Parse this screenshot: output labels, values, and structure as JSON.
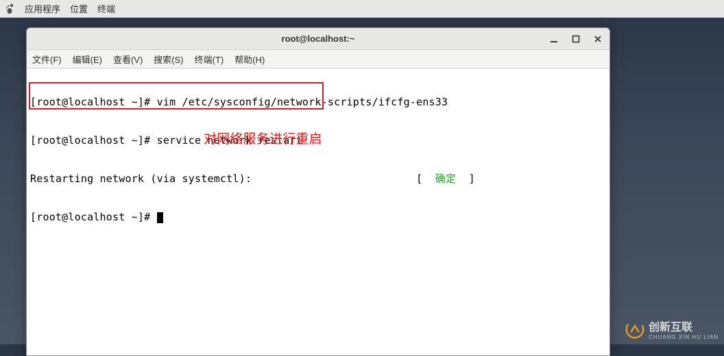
{
  "panel": {
    "apps": "应用程序",
    "places": "位置",
    "terminal": "终端"
  },
  "window": {
    "title": "root@localhost:~"
  },
  "menubar": {
    "file": "文件(F)",
    "edit": "编辑(E)",
    "view": "查看(V)",
    "search": "搜索(S)",
    "terminal": "终端(T)",
    "help": "帮助(H)"
  },
  "terminal": {
    "line1_prompt": "[root@localhost ~]# ",
    "line1_cmd": "vim /etc/sysconfig/network-scripts/ifcfg-ens33",
    "line2_prompt": "[root@localhost ~]# ",
    "line2_cmd": "service network restart",
    "line3_text": "Restarting network (via systemctl):",
    "line3_pad": "                          [  ",
    "line3_ok": "确定",
    "line3_close": "  ]",
    "line4_prompt": "[root@localhost ~]# "
  },
  "annotation": "对网络服务进行重启",
  "watermark": {
    "main": "创新互联",
    "sub": "CHUANG XIN HU LIAN"
  }
}
